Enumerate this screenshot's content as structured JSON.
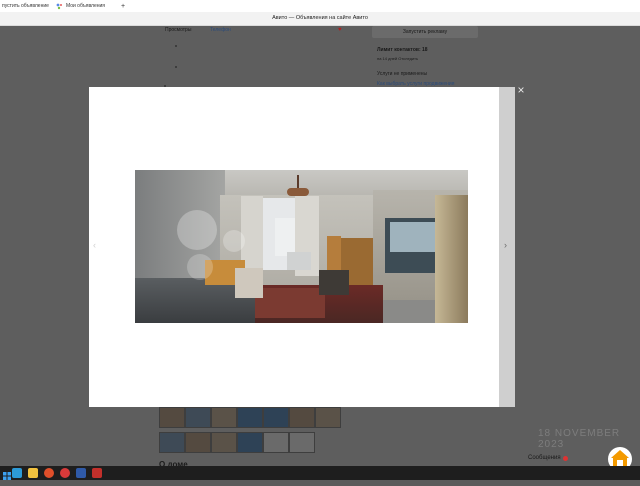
{
  "bookmarks": [
    {
      "label": "пустить объявление",
      "icon": "avito-icon"
    },
    {
      "label": "Мои объявления",
      "icon": "avito-icon"
    }
  ],
  "bookmark_add": "+",
  "tab_title": "Авито — Объявления на сайте Авито",
  "page": {
    "views_label": "Просмотры",
    "views_value": "Телефон",
    "views_count": "?",
    "contacts_limit": "Лимит контактов: 18",
    "contacts_sub": "на 14 дней   Отследить",
    "services_title": "Услуги не применены",
    "services_link": "Как выбрать услуги продвижения",
    "promote_button": "Запустить рекламу",
    "description_heading": "О доме"
  },
  "modal": {
    "close": "×",
    "prev": "‹",
    "next": "›"
  },
  "messages": {
    "label": "Сообщения"
  },
  "watermark": "18 NOVEMBER 2023",
  "colors": {
    "overlay": "#5b5b5b",
    "modal_bg": "#ffffff",
    "accent_orange": "#f39a00"
  }
}
